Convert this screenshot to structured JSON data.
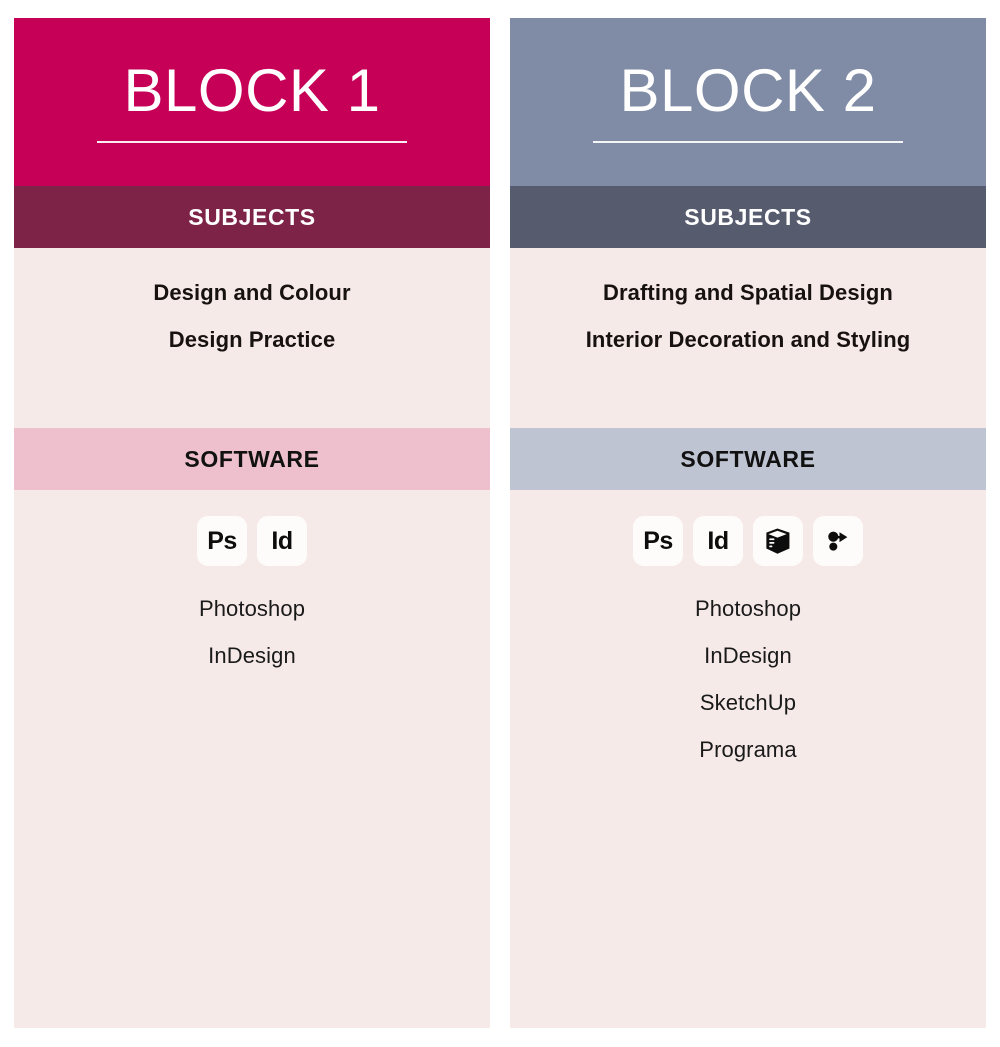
{
  "blocks": [
    {
      "title": "BLOCK 1",
      "header_color": "#C60057",
      "subjects_bar_color": "#7D2348",
      "software_bar_color": "#EEC0CE",
      "subjects_label": "SUBJECTS",
      "software_label": "SOFTWARE",
      "subjects": [
        "Design and Colour",
        "Design Practice"
      ],
      "software_icons": [
        {
          "name": "photoshop-icon",
          "glyph": "Ps"
        },
        {
          "name": "indesign-icon",
          "glyph": "Id"
        }
      ],
      "software": [
        "Photoshop",
        "InDesign"
      ]
    },
    {
      "title": "BLOCK 2",
      "header_color": "#808BA5",
      "subjects_bar_color": "#565B6E",
      "software_bar_color": "#BEC4D2",
      "subjects_label": "SUBJECTS",
      "software_label": "SOFTWARE",
      "subjects": [
        "Drafting and Spatial Design",
        "Interior Decoration and Styling"
      ],
      "software_icons": [
        {
          "name": "photoshop-icon",
          "glyph": "Ps"
        },
        {
          "name": "indesign-icon",
          "glyph": "Id"
        },
        {
          "name": "sketchup-icon",
          "glyph": ""
        },
        {
          "name": "programa-icon",
          "glyph": ""
        }
      ],
      "software": [
        "Photoshop",
        "InDesign",
        "SketchUp",
        "Programa"
      ]
    }
  ],
  "palette": {
    "page_background": "#FFFFFF",
    "pane_background": "#F6EAE9",
    "icon_tile_background": "#FDFCFB",
    "text_dark": "#17120F",
    "text_light": "#FFFFFF"
  }
}
